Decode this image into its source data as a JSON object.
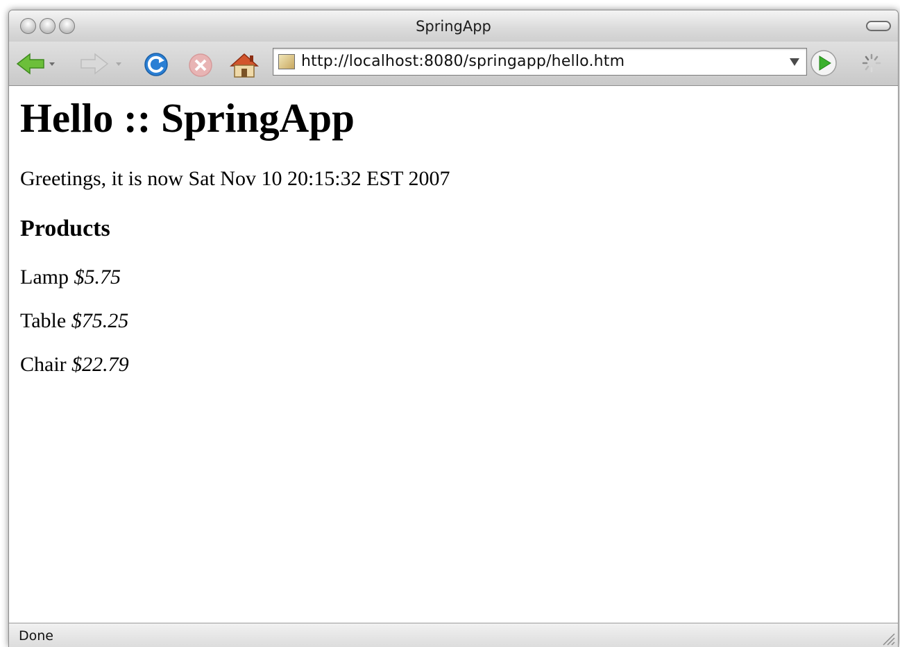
{
  "window": {
    "title": "SpringApp"
  },
  "toolbar": {
    "url": "http://localhost:8080/springapp/hello.htm",
    "icons": [
      "back-arrow-icon",
      "forward-arrow-icon",
      "reload-icon",
      "stop-icon",
      "home-icon",
      "go-icon",
      "throbber-icon"
    ]
  },
  "page": {
    "heading": "Hello :: SpringApp",
    "greeting": "Greetings, it is now Sat Nov 10 20:15:32 EST 2007",
    "products_heading": "Products",
    "products": [
      {
        "name": "Lamp",
        "price": "$5.75"
      },
      {
        "name": "Table",
        "price": "$75.25"
      },
      {
        "name": "Chair",
        "price": "$22.79"
      }
    ]
  },
  "status": {
    "text": "Done"
  },
  "colors": {
    "back_green": "#6cbf3a",
    "reload_blue": "#2a7fd4",
    "stop_red": "#e8b4b4",
    "go_green": "#3ab02c"
  }
}
